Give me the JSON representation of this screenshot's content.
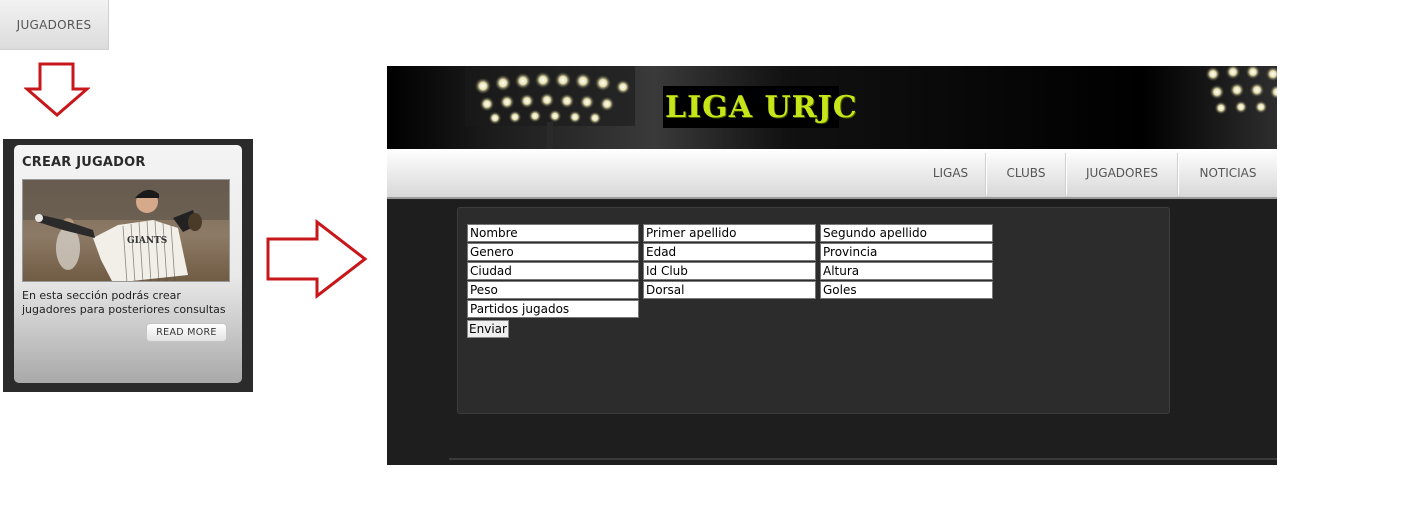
{
  "menu_tab": {
    "label": "JUGADORES"
  },
  "card": {
    "title": "CREAR JUGADOR",
    "text": "En esta sección podrás crear jugadores para posteriores consultas",
    "read_more": "READ MORE"
  },
  "site": {
    "logo_text": "LIGA URJC",
    "nav": [
      "LIGAS",
      "CLUBS",
      "JUGADORES",
      "NOTICIAS"
    ]
  },
  "form": {
    "fields": [
      [
        "Nombre",
        "Primer apellido",
        "Segundo apellido"
      ],
      [
        "Genero",
        "Edad",
        "Provincia"
      ],
      [
        "Ciudad",
        "Id Club",
        "Altura"
      ],
      [
        "Peso",
        "Dorsal",
        "Goles"
      ],
      [
        "Partidos jugados"
      ]
    ],
    "submit": "Enviar"
  },
  "colors": {
    "arrow": "#c8171b",
    "logo": "#c7e619",
    "banner": "#000000"
  },
  "icons": {
    "arrow_down": "arrow-down-icon",
    "arrow_right": "arrow-right-icon"
  }
}
